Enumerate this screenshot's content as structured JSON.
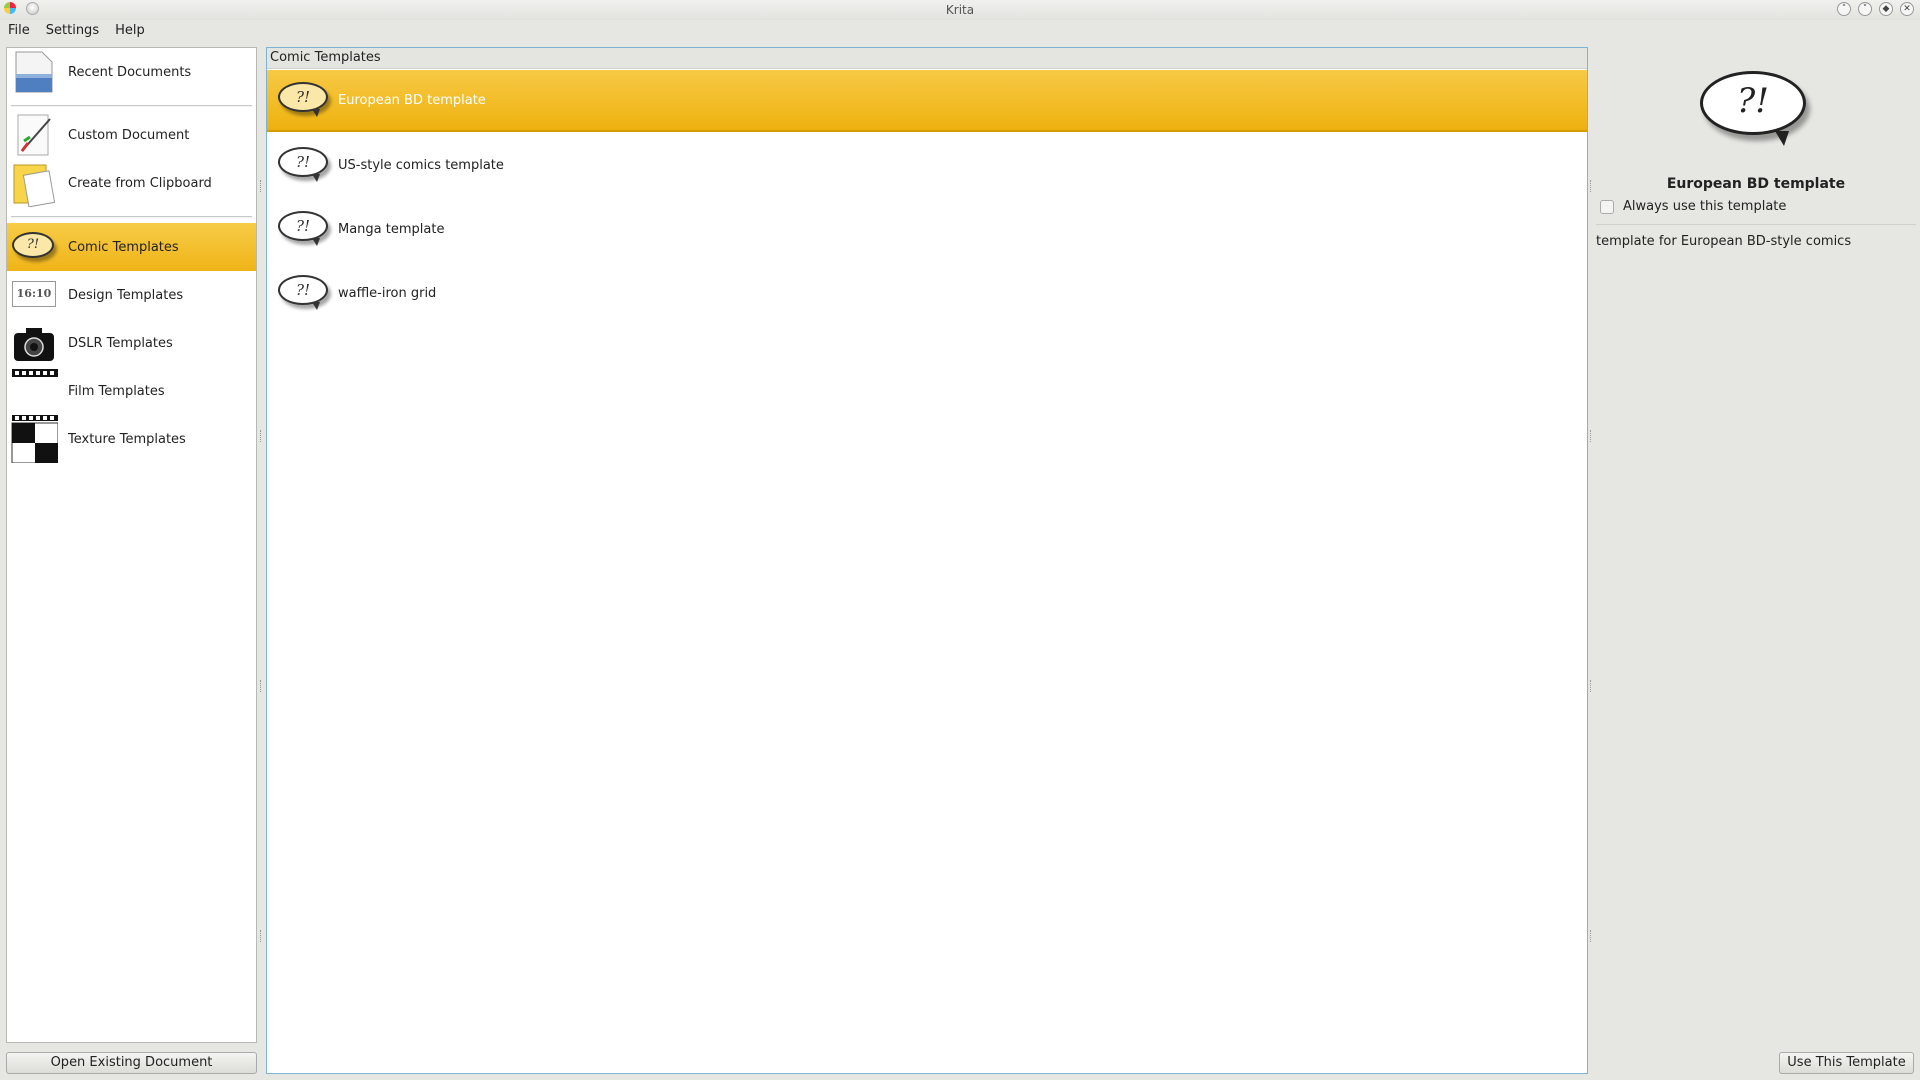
{
  "window": {
    "title": "Krita"
  },
  "menubar": [
    {
      "label": "File"
    },
    {
      "label": "Settings"
    },
    {
      "label": "Help"
    }
  ],
  "sidebar": {
    "items": [
      {
        "label": "Recent Documents",
        "icon": "document-icon"
      },
      {
        "label": "Custom Document",
        "icon": "pen-icon"
      },
      {
        "label": "Create from Clipboard",
        "icon": "clipboard-icon"
      },
      {
        "label": "Comic Templates",
        "icon": "speech-bubble-icon"
      },
      {
        "label": "Design Templates",
        "icon": "ratio-icon",
        "icon_text": "16:10"
      },
      {
        "label": "DSLR Templates",
        "icon": "camera-icon"
      },
      {
        "label": "Film Templates",
        "icon": "film-icon"
      },
      {
        "label": "Texture Templates",
        "icon": "checker-icon"
      }
    ],
    "selected_index": 3,
    "open_button": "Open Existing Document"
  },
  "templates": {
    "header": "Comic Templates",
    "bubble_glyph": "?!",
    "items": [
      {
        "label": "European BD template"
      },
      {
        "label": "US-style comics template"
      },
      {
        "label": "Manga template"
      },
      {
        "label": "waffle-iron grid"
      }
    ],
    "selected_index": 0
  },
  "details": {
    "title": "European BD template",
    "always_use_label": "Always use this template",
    "always_use_checked": false,
    "description": "template for European BD-style comics",
    "use_button": "Use This Template"
  },
  "colors": {
    "selection": "#f0b418",
    "focus_border": "#7fb3d6"
  }
}
